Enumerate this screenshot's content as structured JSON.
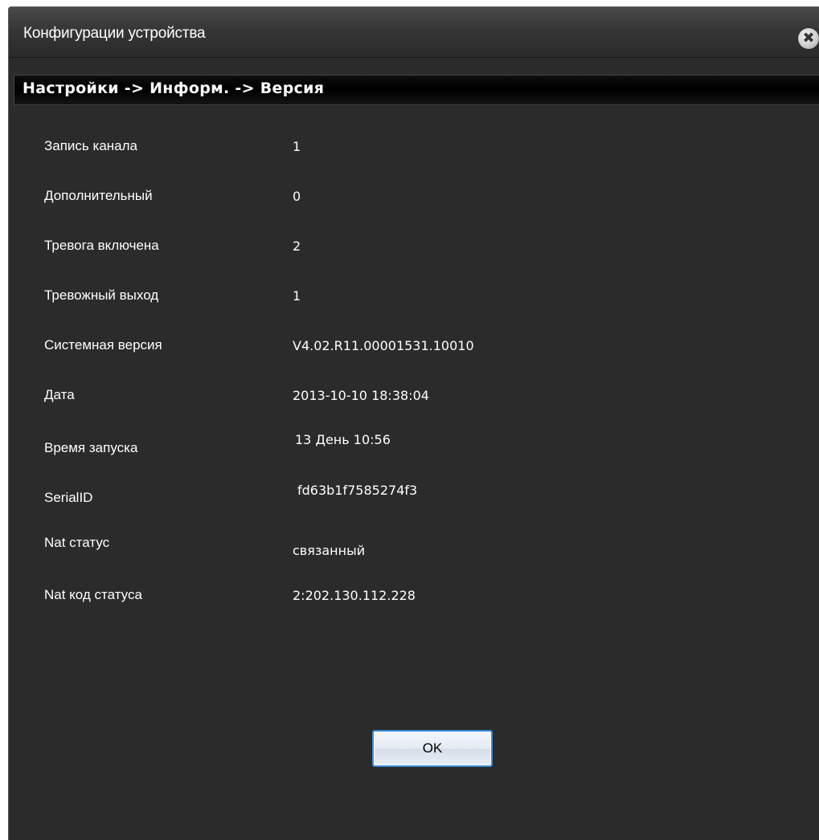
{
  "window": {
    "title": "Конфигурации устройства",
    "close_glyph": "✖"
  },
  "breadcrumb": {
    "text": "Настройки -> Информ. -> Версия"
  },
  "info": {
    "rows": [
      {
        "label": "Запись канала",
        "value": "1"
      },
      {
        "label": "Дополнительный",
        "value": "0"
      },
      {
        "label": "Тревога включена",
        "value": "2"
      },
      {
        "label": "Тревожный выход",
        "value": "1"
      },
      {
        "label": "Системная версия",
        "value": "V4.02.R11.00001531.10010"
      },
      {
        "label": "Дата",
        "value": "2013-10-10 18:38:04"
      },
      {
        "label": "Время запуска",
        "value": "13 День 10:56"
      },
      {
        "label": "SerialID",
        "value": "fd63b1f7585274f3"
      },
      {
        "label": "Nat статус",
        "value": "связанный"
      },
      {
        "label": "Nat код статуса",
        "value": "2:202.130.112.228"
      }
    ]
  },
  "buttons": {
    "ok_label": "OK"
  },
  "colors": {
    "background": "#2b2b2b",
    "breadcrumb_bar": "#000000",
    "text": "#ffffff",
    "ok_border": "#3a8ad8"
  }
}
